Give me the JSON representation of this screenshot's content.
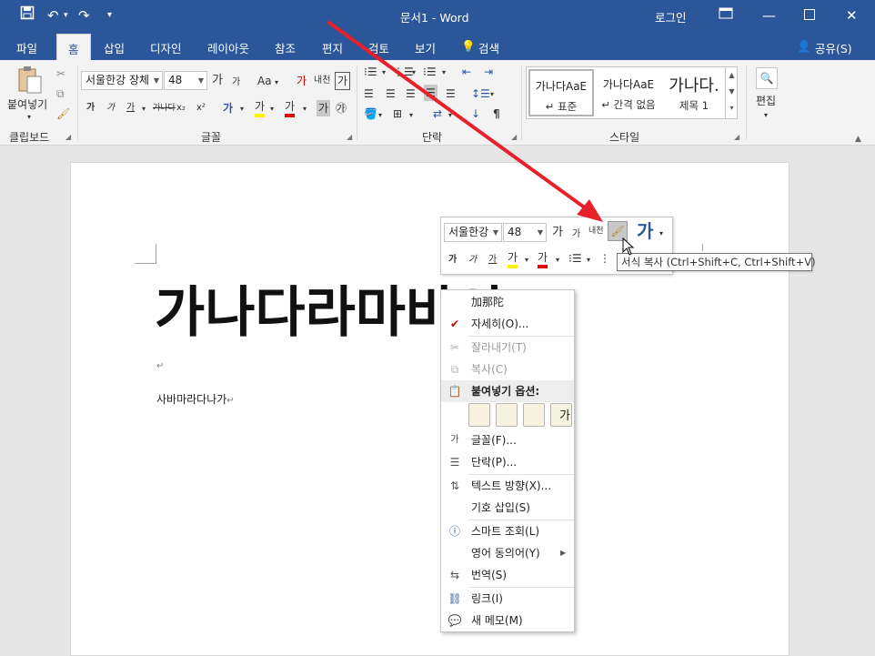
{
  "window": {
    "title": "문서1 - Word",
    "login": "로그인",
    "accent": "#2b579a"
  },
  "tabs": [
    {
      "label": "파일",
      "active": false
    },
    {
      "label": "홈",
      "active": true
    },
    {
      "label": "삽입",
      "active": false
    },
    {
      "label": "디자인",
      "active": false
    },
    {
      "label": "레이아웃",
      "active": false
    },
    {
      "label": "참조",
      "active": false
    },
    {
      "label": "편지",
      "active": false
    },
    {
      "label": "검토",
      "active": false
    },
    {
      "label": "보기",
      "active": false
    },
    {
      "label": "검색",
      "active": false
    }
  ],
  "share_label": "공유(S)",
  "ribbon": {
    "clipboard": {
      "paste_label": "붙여넣기",
      "group_label": "클립보드"
    },
    "font": {
      "font_name": "서울한강 장체",
      "font_size": "48",
      "group_label": "글꼴",
      "grow": "가",
      "shrink": "가",
      "case": "Aa",
      "clear_fmt": "가",
      "phonetic": "내천",
      "charborder": "가",
      "bold": "가",
      "italic": "가",
      "underline": "가",
      "strike": "가나다",
      "subscript": "x₂",
      "superscript": "x²",
      "text_effects": "가",
      "highlight": "가",
      "font_color": "가",
      "char_shading": "가",
      "enclosed": "㉮"
    },
    "paragraph": {
      "group_label": "단락"
    },
    "styles": {
      "group_label": "스타일",
      "items": [
        {
          "preview": "가나다AaE",
          "name": "↵ 표준"
        },
        {
          "preview": "가나다AaE",
          "name": "↵ 간격 없음"
        },
        {
          "preview": "가나다.",
          "name": "제목 1"
        }
      ]
    },
    "editing": {
      "label": "편집"
    }
  },
  "document": {
    "heading": "가나다라마바사",
    "line2": "사바마라다나가"
  },
  "mini_toolbar": {
    "font_name": "서울한강",
    "font_size": "48",
    "grow": "가",
    "shrink": "가",
    "phonetic": "내천",
    "styles": "가",
    "bold": "가",
    "italic": "가",
    "underline": "가",
    "highlight": "가",
    "font_color": "가"
  },
  "tooltip": "서식 복사 (Ctrl+Shift+C, Ctrl+Shift+V)",
  "context_menu": {
    "items": [
      {
        "label": "加那陀",
        "icon": "",
        "disabled": false
      },
      {
        "label": "자세히(O)...",
        "icon": "hanja-icon",
        "disabled": false
      },
      {
        "label": "잘라내기(T)",
        "icon": "cut-icon",
        "disabled": true
      },
      {
        "label": "복사(C)",
        "icon": "copy-icon",
        "disabled": true
      },
      {
        "label": "붙여넣기 옵션:",
        "icon": "paste-icon",
        "disabled": false
      },
      {
        "label": "글꼴(F)...",
        "icon": "font-icon",
        "disabled": false
      },
      {
        "label": "단락(P)...",
        "icon": "paragraph-icon",
        "disabled": false
      },
      {
        "label": "텍스트 방향(X)...",
        "icon": "text-direction-icon",
        "disabled": false
      },
      {
        "label": "기호 삽입(S)",
        "icon": "",
        "disabled": false
      },
      {
        "label": "스마트 조회(L)",
        "icon": "smart-lookup-icon",
        "disabled": false
      },
      {
        "label": "영어 동의어(Y)",
        "icon": "",
        "disabled": false
      },
      {
        "label": "번역(S)",
        "icon": "translate-icon",
        "disabled": false
      },
      {
        "label": "링크(I)",
        "icon": "link-icon",
        "disabled": false
      },
      {
        "label": "새 메모(M)",
        "icon": "new-comment-icon",
        "disabled": false
      }
    ],
    "paste_option_glyph": "가"
  }
}
